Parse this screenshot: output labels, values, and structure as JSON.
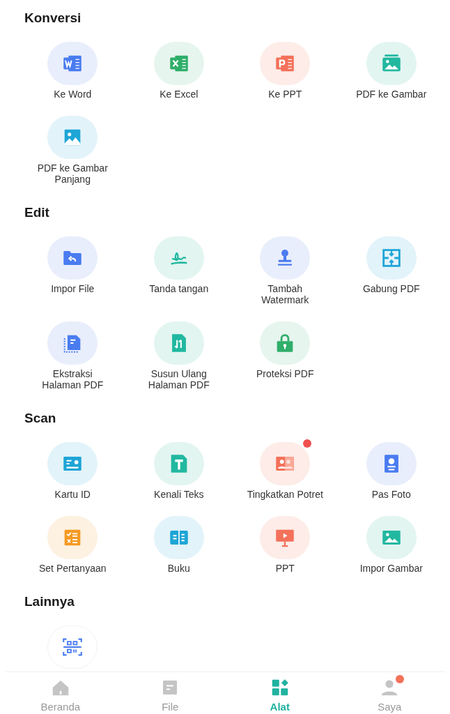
{
  "sections": [
    {
      "title": "Konversi",
      "items": [
        {
          "label": "Ke Word",
          "badge": false
        },
        {
          "label": "Ke Excel",
          "badge": false
        },
        {
          "label": "Ke PPT",
          "badge": false
        },
        {
          "label": "PDF ke Gambar",
          "badge": false
        },
        {
          "label": "PDF ke Gambar Panjang",
          "badge": false
        }
      ]
    },
    {
      "title": "Edit",
      "items": [
        {
          "label": "Impor File",
          "badge": false
        },
        {
          "label": "Tanda tangan",
          "badge": false
        },
        {
          "label": "Tambah Watermark",
          "badge": false
        },
        {
          "label": "Gabung PDF",
          "badge": false
        },
        {
          "label": "Ekstraksi Halaman PDF",
          "badge": false
        },
        {
          "label": "Susun Ulang Halaman PDF",
          "badge": false
        },
        {
          "label": "Proteksi PDF",
          "badge": false
        }
      ]
    },
    {
      "title": "Scan",
      "items": [
        {
          "label": "Kartu ID",
          "badge": false
        },
        {
          "label": "Kenali Teks",
          "badge": false
        },
        {
          "label": "Tingkatkan Potret",
          "badge": true
        },
        {
          "label": "Pas Foto",
          "badge": false
        },
        {
          "label": "Set Pertanyaan",
          "badge": false
        },
        {
          "label": "Buku",
          "badge": false
        },
        {
          "label": "PPT",
          "badge": false
        },
        {
          "label": "Impor Gambar",
          "badge": false
        }
      ]
    },
    {
      "title": "Lainnya",
      "items": [
        {
          "badge": false
        }
      ]
    }
  ],
  "nav": [
    {
      "label": "Beranda",
      "selected": false,
      "badge": false
    },
    {
      "label": "File",
      "selected": false,
      "badge": false
    },
    {
      "label": "Alat",
      "selected": true,
      "badge": false
    },
    {
      "label": "Saya",
      "selected": false,
      "badge": true
    }
  ]
}
